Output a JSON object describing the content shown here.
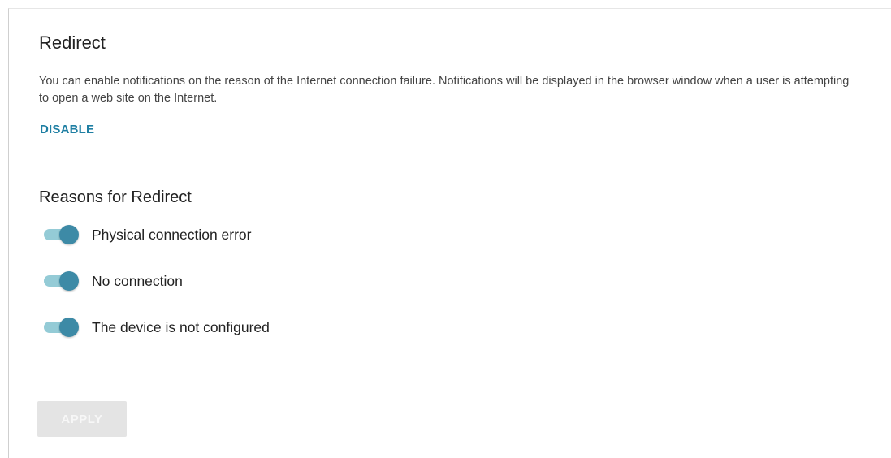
{
  "section": {
    "title": "Redirect",
    "description": "You can enable notifications on the reason of the Internet connection failure. Notifications will be displayed in the browser window when a user is attempting to open a web site on the Internet.",
    "disable_label": "DISABLE"
  },
  "reasons": {
    "title": "Reasons for Redirect",
    "items": [
      {
        "label": "Physical connection error",
        "enabled": true
      },
      {
        "label": "No connection",
        "enabled": true
      },
      {
        "label": "The device is not configured",
        "enabled": true
      }
    ]
  },
  "actions": {
    "apply_label": "APPLY",
    "apply_enabled": false
  },
  "colors": {
    "accent": "#3d8aa6",
    "link": "#1f7fa3",
    "toggle_track": "#94cbd6",
    "disabled_button": "#e4e4e4"
  }
}
